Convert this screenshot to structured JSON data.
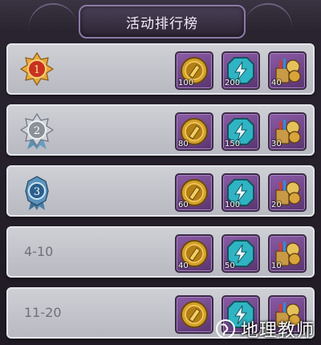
{
  "header": {
    "title": "活动排行榜"
  },
  "colors": {
    "row_bg": "#c5c6cd",
    "reward_frame": "#6e4388",
    "gold": "#d6a12a",
    "teal": "#2fb4c4"
  },
  "rows": [
    {
      "rank_label": "",
      "badge": "gold-rank-1-badge",
      "rewards": [
        {
          "icon": "gold-coin-icon",
          "qty": "100"
        },
        {
          "icon": "lightning-energy-icon",
          "qty": "200"
        },
        {
          "icon": "treasure-bundle-icon",
          "qty": "40"
        }
      ]
    },
    {
      "rank_label": "",
      "badge": "silver-rank-2-badge",
      "rewards": [
        {
          "icon": "gold-coin-icon",
          "qty": "80"
        },
        {
          "icon": "lightning-energy-icon",
          "qty": "150"
        },
        {
          "icon": "treasure-bundle-icon",
          "qty": "30"
        }
      ]
    },
    {
      "rank_label": "",
      "badge": "blue-rank-3-badge",
      "rewards": [
        {
          "icon": "gold-coin-icon",
          "qty": "60"
        },
        {
          "icon": "lightning-energy-icon",
          "qty": "100"
        },
        {
          "icon": "treasure-bundle-icon",
          "qty": "20"
        }
      ]
    },
    {
      "rank_label": "4-10",
      "rewards": [
        {
          "icon": "gold-coin-icon",
          "qty": "40"
        },
        {
          "icon": "lightning-energy-icon",
          "qty": "50"
        },
        {
          "icon": "treasure-bundle-icon",
          "qty": "10"
        }
      ]
    },
    {
      "rank_label": "11-20",
      "rewards": [
        {
          "icon": "gold-coin-icon",
          "qty": ""
        },
        {
          "icon": "lightning-energy-icon",
          "qty": ""
        },
        {
          "icon": "treasure-bundle-icon",
          "qty": ""
        }
      ]
    }
  ],
  "watermark": {
    "text": "地理教师"
  }
}
